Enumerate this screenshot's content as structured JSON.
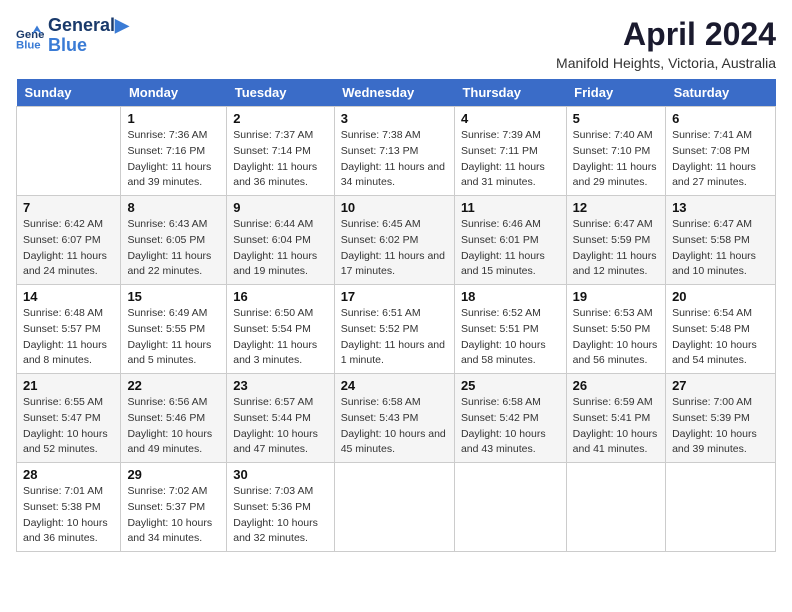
{
  "header": {
    "logo_line1": "General",
    "logo_line2": "Blue",
    "month_title": "April 2024",
    "location": "Manifold Heights, Victoria, Australia"
  },
  "weekdays": [
    "Sunday",
    "Monday",
    "Tuesday",
    "Wednesday",
    "Thursday",
    "Friday",
    "Saturday"
  ],
  "weeks": [
    [
      {
        "day": "",
        "sunrise": "",
        "sunset": "",
        "daylight": ""
      },
      {
        "day": "1",
        "sunrise": "Sunrise: 7:36 AM",
        "sunset": "Sunset: 7:16 PM",
        "daylight": "Daylight: 11 hours and 39 minutes."
      },
      {
        "day": "2",
        "sunrise": "Sunrise: 7:37 AM",
        "sunset": "Sunset: 7:14 PM",
        "daylight": "Daylight: 11 hours and 36 minutes."
      },
      {
        "day": "3",
        "sunrise": "Sunrise: 7:38 AM",
        "sunset": "Sunset: 7:13 PM",
        "daylight": "Daylight: 11 hours and 34 minutes."
      },
      {
        "day": "4",
        "sunrise": "Sunrise: 7:39 AM",
        "sunset": "Sunset: 7:11 PM",
        "daylight": "Daylight: 11 hours and 31 minutes."
      },
      {
        "day": "5",
        "sunrise": "Sunrise: 7:40 AM",
        "sunset": "Sunset: 7:10 PM",
        "daylight": "Daylight: 11 hours and 29 minutes."
      },
      {
        "day": "6",
        "sunrise": "Sunrise: 7:41 AM",
        "sunset": "Sunset: 7:08 PM",
        "daylight": "Daylight: 11 hours and 27 minutes."
      }
    ],
    [
      {
        "day": "7",
        "sunrise": "Sunrise: 6:42 AM",
        "sunset": "Sunset: 6:07 PM",
        "daylight": "Daylight: 11 hours and 24 minutes."
      },
      {
        "day": "8",
        "sunrise": "Sunrise: 6:43 AM",
        "sunset": "Sunset: 6:05 PM",
        "daylight": "Daylight: 11 hours and 22 minutes."
      },
      {
        "day": "9",
        "sunrise": "Sunrise: 6:44 AM",
        "sunset": "Sunset: 6:04 PM",
        "daylight": "Daylight: 11 hours and 19 minutes."
      },
      {
        "day": "10",
        "sunrise": "Sunrise: 6:45 AM",
        "sunset": "Sunset: 6:02 PM",
        "daylight": "Daylight: 11 hours and 17 minutes."
      },
      {
        "day": "11",
        "sunrise": "Sunrise: 6:46 AM",
        "sunset": "Sunset: 6:01 PM",
        "daylight": "Daylight: 11 hours and 15 minutes."
      },
      {
        "day": "12",
        "sunrise": "Sunrise: 6:47 AM",
        "sunset": "Sunset: 5:59 PM",
        "daylight": "Daylight: 11 hours and 12 minutes."
      },
      {
        "day": "13",
        "sunrise": "Sunrise: 6:47 AM",
        "sunset": "Sunset: 5:58 PM",
        "daylight": "Daylight: 11 hours and 10 minutes."
      }
    ],
    [
      {
        "day": "14",
        "sunrise": "Sunrise: 6:48 AM",
        "sunset": "Sunset: 5:57 PM",
        "daylight": "Daylight: 11 hours and 8 minutes."
      },
      {
        "day": "15",
        "sunrise": "Sunrise: 6:49 AM",
        "sunset": "Sunset: 5:55 PM",
        "daylight": "Daylight: 11 hours and 5 minutes."
      },
      {
        "day": "16",
        "sunrise": "Sunrise: 6:50 AM",
        "sunset": "Sunset: 5:54 PM",
        "daylight": "Daylight: 11 hours and 3 minutes."
      },
      {
        "day": "17",
        "sunrise": "Sunrise: 6:51 AM",
        "sunset": "Sunset: 5:52 PM",
        "daylight": "Daylight: 11 hours and 1 minute."
      },
      {
        "day": "18",
        "sunrise": "Sunrise: 6:52 AM",
        "sunset": "Sunset: 5:51 PM",
        "daylight": "Daylight: 10 hours and 58 minutes."
      },
      {
        "day": "19",
        "sunrise": "Sunrise: 6:53 AM",
        "sunset": "Sunset: 5:50 PM",
        "daylight": "Daylight: 10 hours and 56 minutes."
      },
      {
        "day": "20",
        "sunrise": "Sunrise: 6:54 AM",
        "sunset": "Sunset: 5:48 PM",
        "daylight": "Daylight: 10 hours and 54 minutes."
      }
    ],
    [
      {
        "day": "21",
        "sunrise": "Sunrise: 6:55 AM",
        "sunset": "Sunset: 5:47 PM",
        "daylight": "Daylight: 10 hours and 52 minutes."
      },
      {
        "day": "22",
        "sunrise": "Sunrise: 6:56 AM",
        "sunset": "Sunset: 5:46 PM",
        "daylight": "Daylight: 10 hours and 49 minutes."
      },
      {
        "day": "23",
        "sunrise": "Sunrise: 6:57 AM",
        "sunset": "Sunset: 5:44 PM",
        "daylight": "Daylight: 10 hours and 47 minutes."
      },
      {
        "day": "24",
        "sunrise": "Sunrise: 6:58 AM",
        "sunset": "Sunset: 5:43 PM",
        "daylight": "Daylight: 10 hours and 45 minutes."
      },
      {
        "day": "25",
        "sunrise": "Sunrise: 6:58 AM",
        "sunset": "Sunset: 5:42 PM",
        "daylight": "Daylight: 10 hours and 43 minutes."
      },
      {
        "day": "26",
        "sunrise": "Sunrise: 6:59 AM",
        "sunset": "Sunset: 5:41 PM",
        "daylight": "Daylight: 10 hours and 41 minutes."
      },
      {
        "day": "27",
        "sunrise": "Sunrise: 7:00 AM",
        "sunset": "Sunset: 5:39 PM",
        "daylight": "Daylight: 10 hours and 39 minutes."
      }
    ],
    [
      {
        "day": "28",
        "sunrise": "Sunrise: 7:01 AM",
        "sunset": "Sunset: 5:38 PM",
        "daylight": "Daylight: 10 hours and 36 minutes."
      },
      {
        "day": "29",
        "sunrise": "Sunrise: 7:02 AM",
        "sunset": "Sunset: 5:37 PM",
        "daylight": "Daylight: 10 hours and 34 minutes."
      },
      {
        "day": "30",
        "sunrise": "Sunrise: 7:03 AM",
        "sunset": "Sunset: 5:36 PM",
        "daylight": "Daylight: 10 hours and 32 minutes."
      },
      {
        "day": "",
        "sunrise": "",
        "sunset": "",
        "daylight": ""
      },
      {
        "day": "",
        "sunrise": "",
        "sunset": "",
        "daylight": ""
      },
      {
        "day": "",
        "sunrise": "",
        "sunset": "",
        "daylight": ""
      },
      {
        "day": "",
        "sunrise": "",
        "sunset": "",
        "daylight": ""
      }
    ]
  ]
}
